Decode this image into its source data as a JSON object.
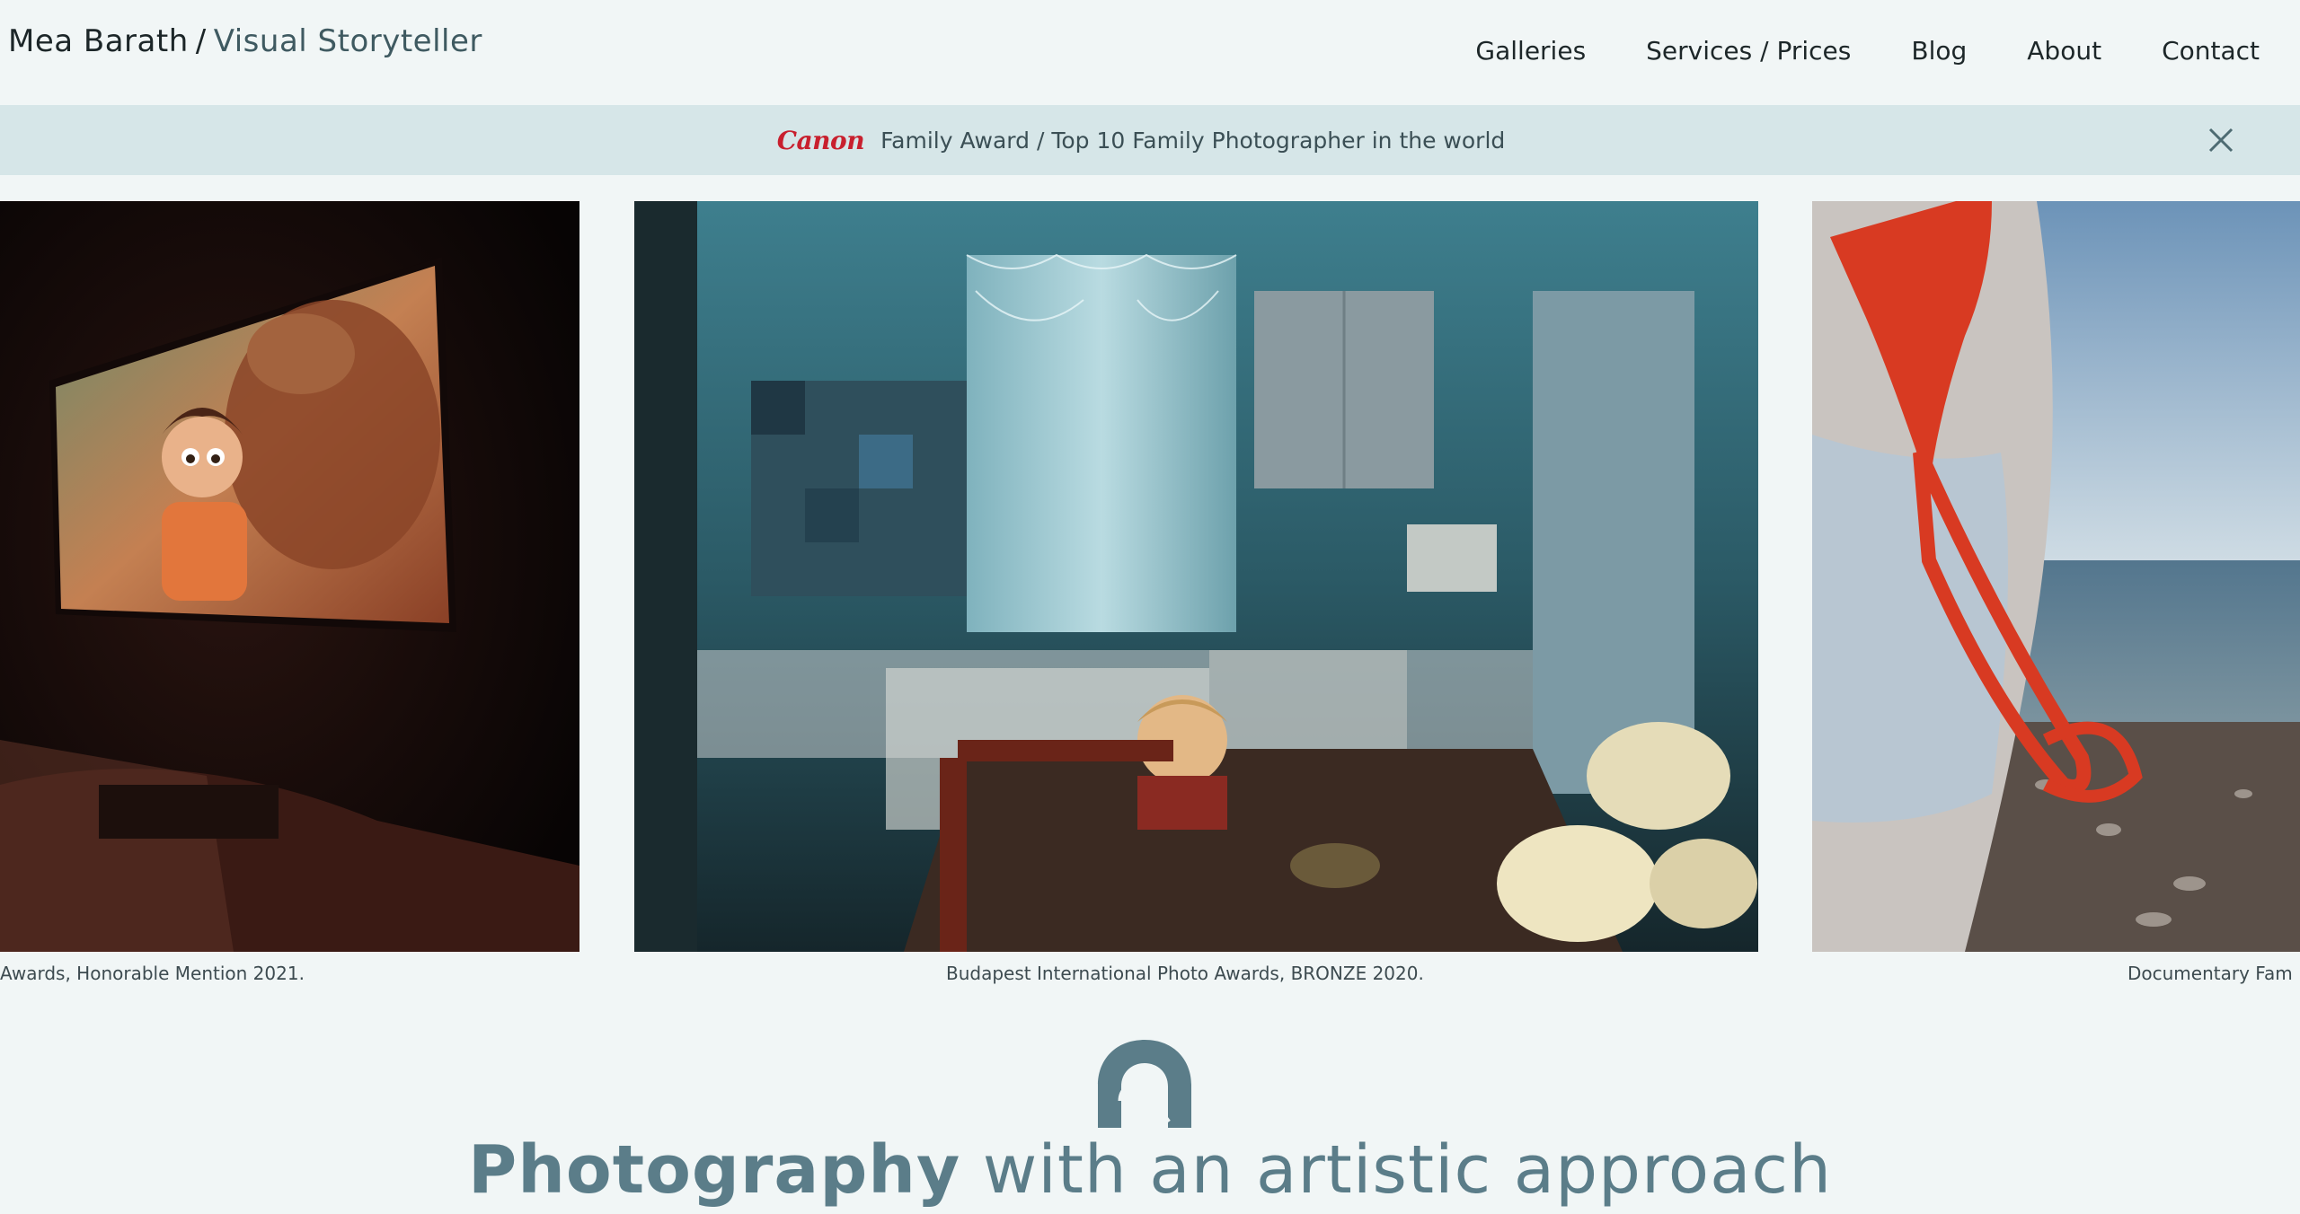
{
  "header": {
    "brand_name": "Mea Barath",
    "brand_separator": "/",
    "brand_tagline": "Visual Storyteller",
    "nav": [
      {
        "label": "Galleries"
      },
      {
        "label": "Services / Prices"
      },
      {
        "label": "Blog"
      },
      {
        "label": "About"
      },
      {
        "label": "Contact"
      }
    ]
  },
  "banner": {
    "logo_text": "Canon",
    "text": "Family Award / Top 10 Family Photographer in the world",
    "close_icon": "close-icon"
  },
  "gallery": {
    "photos": [
      {
        "caption": "Awards, Honorable Mention 2021."
      },
      {
        "caption": "Budapest International Photo Awards, BRONZE 2020."
      },
      {
        "caption": "Documentary Fam"
      }
    ]
  },
  "section": {
    "logo_icon": "heron-logo-icon",
    "headline_bold": "Photography",
    "headline_rest": "with an artistic approach"
  },
  "colors": {
    "background": "#f1f6f6",
    "banner_bg": "#d6e6e8",
    "accent": "#5b7d89",
    "canon_red": "#c8202e"
  }
}
